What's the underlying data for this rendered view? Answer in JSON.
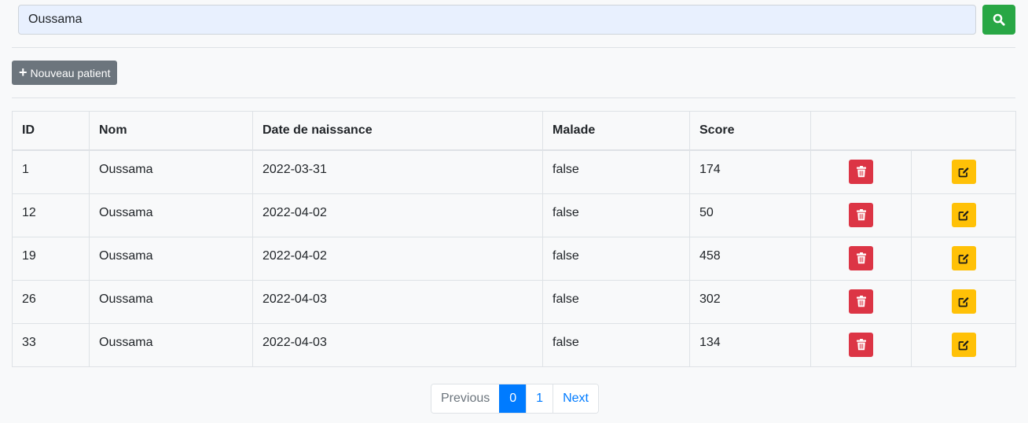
{
  "search": {
    "value": "Oussama",
    "button_icon": "search-icon"
  },
  "toolbar": {
    "new_patient_label": "Nouveau patient",
    "new_patient_icon": "plus-icon"
  },
  "table": {
    "headers": [
      "ID",
      "Nom",
      "Date de naissance",
      "Malade",
      "Score"
    ],
    "rows": [
      {
        "id": "1",
        "nom": "Oussama",
        "date": "2022-03-31",
        "malade": "false",
        "score": "174"
      },
      {
        "id": "12",
        "nom": "Oussama",
        "date": "2022-04-02",
        "malade": "false",
        "score": "50"
      },
      {
        "id": "19",
        "nom": "Oussama",
        "date": "2022-04-02",
        "malade": "false",
        "score": "458"
      },
      {
        "id": "26",
        "nom": "Oussama",
        "date": "2022-04-03",
        "malade": "false",
        "score": "302"
      },
      {
        "id": "33",
        "nom": "Oussama",
        "date": "2022-04-03",
        "malade": "false",
        "score": "134"
      }
    ],
    "delete_icon": "trash-icon",
    "edit_icon": "edit-icon"
  },
  "pagination": {
    "previous": "Previous",
    "pages": [
      "0",
      "1"
    ],
    "current_page": "0",
    "next": "Next"
  },
  "colors": {
    "success": "#28a745",
    "secondary": "#6c757d",
    "danger": "#dc3545",
    "warning": "#ffc107",
    "primary": "#007bff"
  }
}
